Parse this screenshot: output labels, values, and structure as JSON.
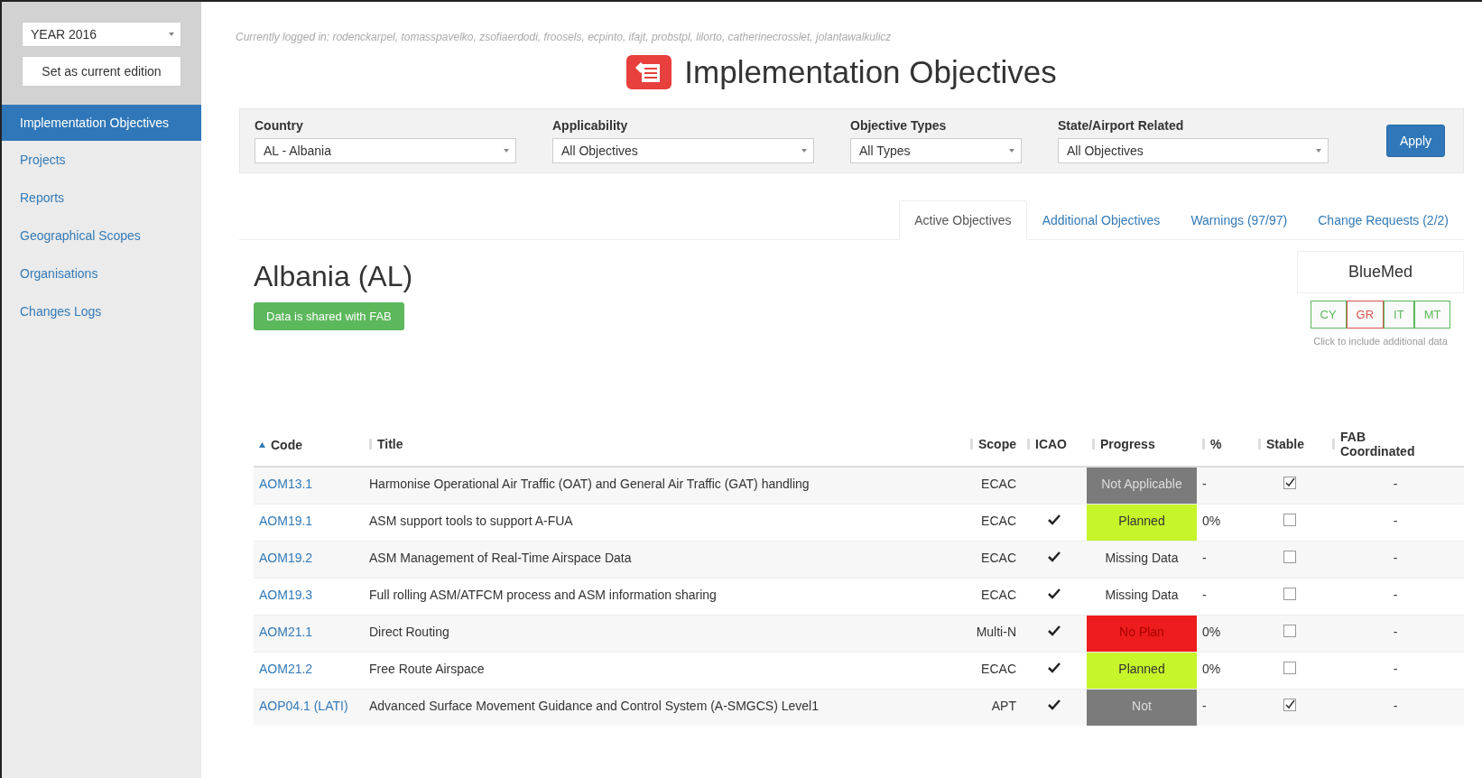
{
  "sidebar": {
    "edition_select": {
      "value": "YEAR 2016"
    },
    "edition_button": "Set as current edition",
    "items": [
      {
        "label": "Implementation Objectives",
        "selected": true
      },
      {
        "label": "Projects",
        "selected": false
      },
      {
        "label": "Reports",
        "selected": false
      },
      {
        "label": "Geographical Scopes",
        "selected": false
      },
      {
        "label": "Organisations",
        "selected": false
      },
      {
        "label": "Changes Logs",
        "selected": false
      }
    ]
  },
  "logged_in": "Currently logged in: rodenckarpel, tomasspavelko, zsofiaerdodi, froosels, ecpinto, ifajt, probstpl, lilorto, catherinecrosslet, jolantawalkulicz",
  "page_title": "Implementation Objectives",
  "filters": [
    {
      "label": "Country",
      "value": "AL - Albania"
    },
    {
      "label": "Applicability",
      "value": "All Objectives"
    },
    {
      "label": "Objective Types",
      "value": "All Types"
    },
    {
      "label": "State/Airport Related",
      "value": "All Objectives"
    }
  ],
  "apply_button": "Apply",
  "tabs": [
    {
      "label": "Active Objectives",
      "selected": true
    },
    {
      "label": "Additional Objectives",
      "selected": false
    },
    {
      "label": "Warnings (97/97)",
      "selected": false
    },
    {
      "label": "Change Requests (2/2)",
      "selected": false
    }
  ],
  "country_heading": "Albania (AL)",
  "shared_badge": "Data is shared with FAB",
  "fab": {
    "name": "BlueMed",
    "countries": [
      {
        "code": "CY",
        "color": "#5cb85c"
      },
      {
        "code": "GR",
        "color": "#d9534f"
      },
      {
        "code": "IT",
        "color": "#5cb85c"
      },
      {
        "code": "MT",
        "color": "#5cb85c"
      }
    ],
    "hint": "Click to include additional data"
  },
  "table": {
    "columns": [
      {
        "label": "Code",
        "sorted": true
      },
      {
        "label": "Title",
        "sorted": false
      },
      {
        "label": "Scope",
        "sorted": false
      },
      {
        "label": "ICAO",
        "sorted": false
      },
      {
        "label": "Progress",
        "sorted": false
      },
      {
        "label": "%",
        "sorted": false
      },
      {
        "label": "Stable",
        "sorted": false
      },
      {
        "label": "FAB Coordinated",
        "sorted": false
      }
    ],
    "rows": [
      {
        "code": "AOM13.1",
        "title": "Harmonise Operational Air Traffic (OAT) and General Air Traffic (GAT) handling",
        "scope": "ECAC",
        "icao": false,
        "progress": {
          "kind": "na",
          "text": "Not Applicable"
        },
        "percent": "-",
        "stable": true,
        "fab": "-"
      },
      {
        "code": "AOM19.1",
        "title": "ASM support tools to support A-FUA",
        "scope": "ECAC",
        "icao": true,
        "progress": {
          "kind": "planned",
          "text": "Planned"
        },
        "percent": "0%",
        "stable": false,
        "fab": "-"
      },
      {
        "code": "AOM19.2",
        "title": "ASM Management of Real-Time Airspace Data",
        "scope": "ECAC",
        "icao": true,
        "progress": {
          "kind": "missing",
          "text": "Missing Data"
        },
        "percent": "-",
        "stable": false,
        "fab": "-"
      },
      {
        "code": "AOM19.3",
        "title": "Full rolling ASM/ATFCM process and ASM information sharing",
        "scope": "ECAC",
        "icao": true,
        "progress": {
          "kind": "missing",
          "text": "Missing Data"
        },
        "percent": "-",
        "stable": false,
        "fab": "-"
      },
      {
        "code": "AOM21.1",
        "title": "Direct Routing",
        "scope": "Multi-N",
        "icao": true,
        "progress": {
          "kind": "noplan",
          "text": "No Plan"
        },
        "percent": "0%",
        "stable": false,
        "fab": "-"
      },
      {
        "code": "AOM21.2",
        "title": "Free Route Airspace",
        "scope": "ECAC",
        "icao": true,
        "progress": {
          "kind": "planned",
          "text": "Planned"
        },
        "percent": "0%",
        "stable": false,
        "fab": "-"
      },
      {
        "code": "AOP04.1 (LATI)",
        "title": "Advanced Surface Movement Guidance and Control System (A-SMGCS) Level1",
        "scope": "APT",
        "icao": true,
        "progress": {
          "kind": "na",
          "text": "Not"
        },
        "percent": "-",
        "stable": true,
        "fab": "-"
      }
    ]
  }
}
